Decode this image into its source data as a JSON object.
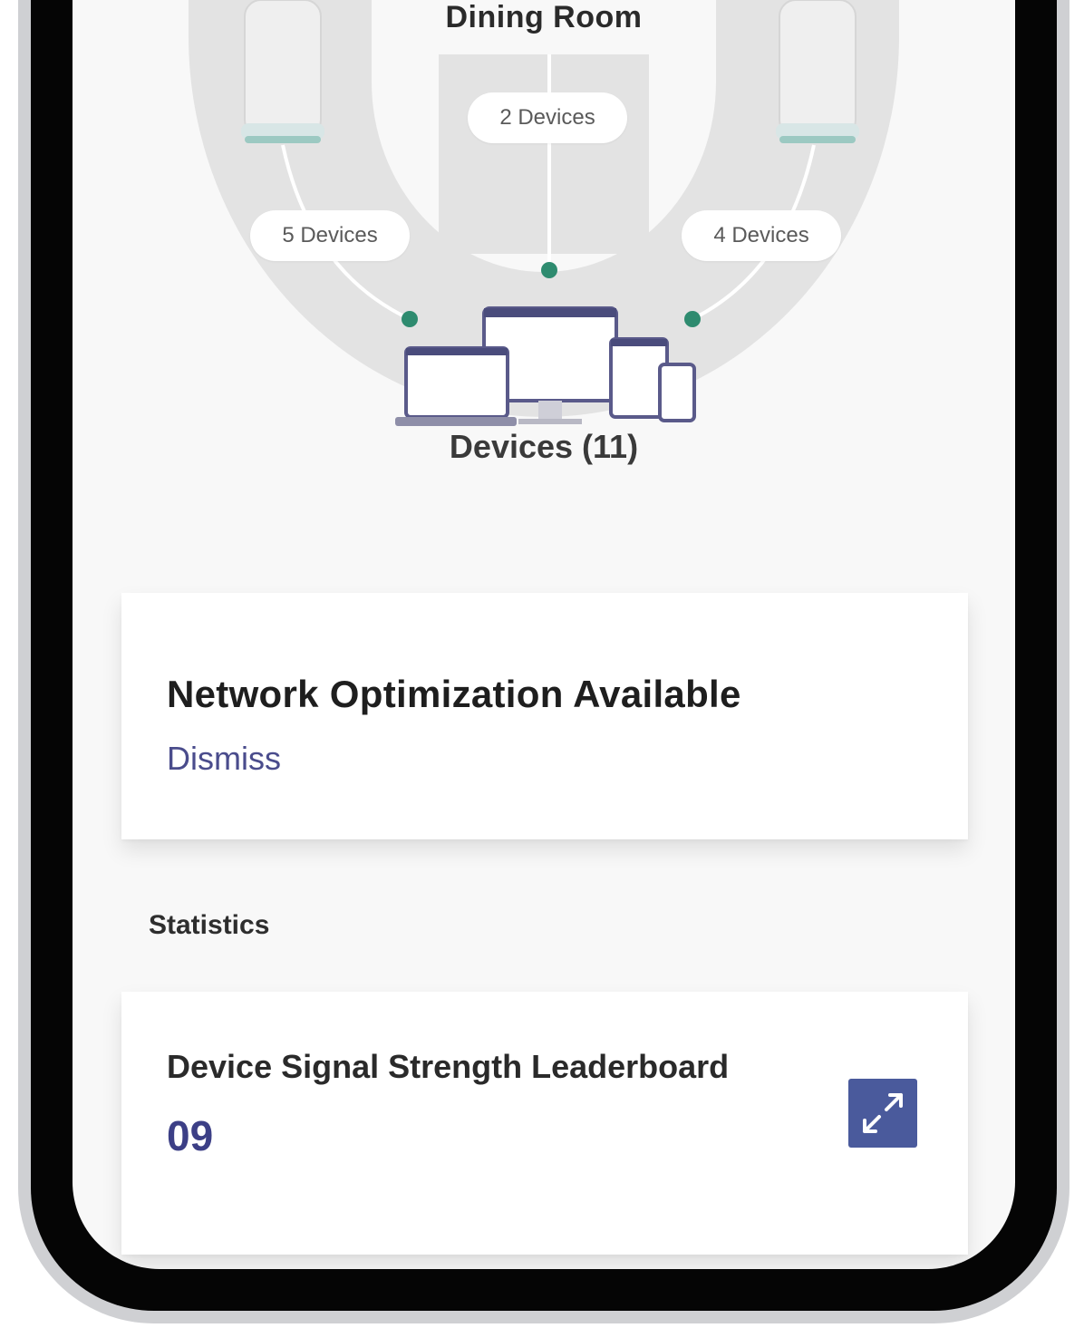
{
  "topology": {
    "room_title": "Dining Room",
    "center_node_label": "2 Devices",
    "left_node_label": "5 Devices",
    "right_node_label": "4 Devices",
    "devices_label": "Devices (11)"
  },
  "optimization_card": {
    "title": "Network Optimization Available",
    "dismiss_label": "Dismiss"
  },
  "statistics": {
    "section_label": "Statistics",
    "leaderboard_title": "Device Signal Strength Leaderboard",
    "leaderboard_value": "09",
    "expand_icon": "expand-arrows-icon"
  },
  "colors": {
    "accent": "#4a5a9c",
    "link": "#4a4c8c",
    "node_dot": "#2e8b6f",
    "ring_gray": "#e2e2e2"
  }
}
